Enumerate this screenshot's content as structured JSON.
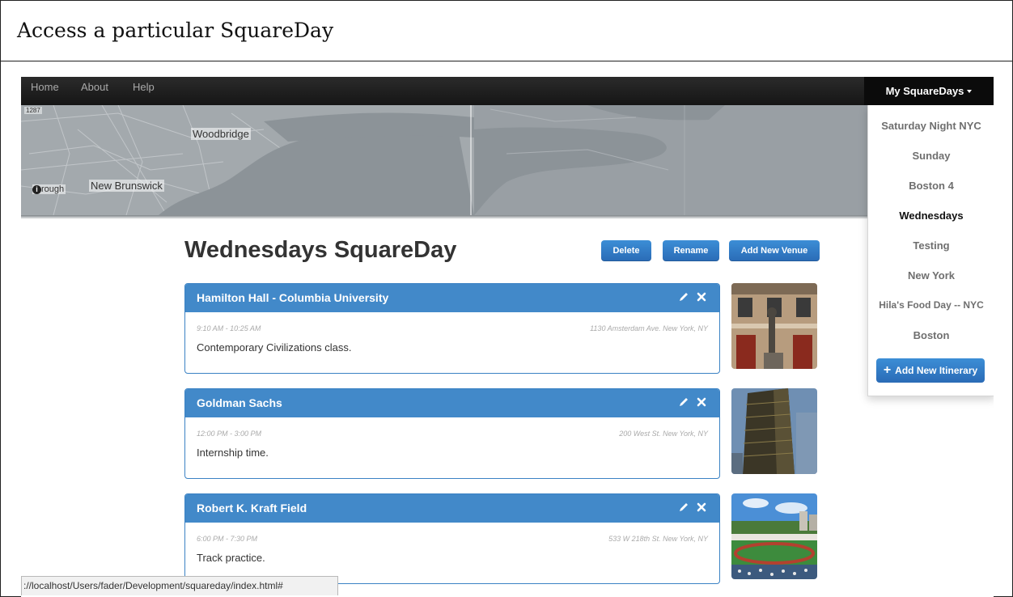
{
  "caption": "Access a particular SquareDay",
  "nav": {
    "links": [
      "Home",
      "About",
      "Help"
    ],
    "my_squaredays": "My SquareDays"
  },
  "map": {
    "labels": [
      "Woodbridge",
      "New Brunswick",
      "rough",
      "1287"
    ]
  },
  "page": {
    "title": "Wednesdays SquareDay",
    "buttons": {
      "delete": "Delete",
      "rename": "Rename",
      "add_venue": "Add New Venue"
    }
  },
  "venues": [
    {
      "name": "Hamilton Hall - Columbia University",
      "time": "9:10 AM - 10:25 AM",
      "address": "1130 Amsterdam Ave. New York, NY",
      "description": "Contemporary Civilizations class."
    },
    {
      "name": "Goldman Sachs",
      "time": "12:00 PM - 3:00 PM",
      "address": "200 West St. New York, NY",
      "description": "Internship time."
    },
    {
      "name": "Robert K. Kraft Field",
      "time": "6:00 PM - 7:30 PM",
      "address": "533 W 218th St. New York, NY",
      "description": "Track practice."
    }
  ],
  "dropdown": {
    "items": [
      "Saturday Night NYC",
      "Sunday",
      "Boston 4",
      "Wednesdays",
      "Testing",
      "New York",
      "Hila's Food Day -- NYC",
      "Boston"
    ],
    "active": "Wednesdays",
    "add_itinerary": "Add New Itinerary"
  },
  "status_url": "://localhost/Users/fader/Development/squareday/index.html#",
  "colors": {
    "accent": "#4289c9",
    "navbar": "#1e1e1e",
    "map": "#9aa1a6"
  },
  "icons": [
    "pencil-icon",
    "close-icon",
    "plus-icon",
    "caret-down-icon",
    "info-icon"
  ]
}
